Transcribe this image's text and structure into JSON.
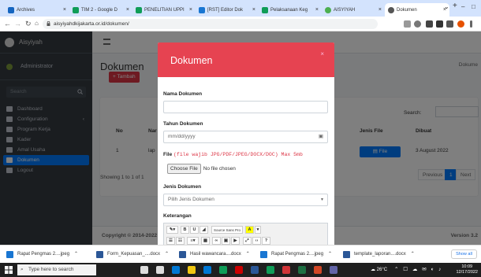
{
  "browser": {
    "tabs": [
      {
        "label": "Archives",
        "color": "#1565c0"
      },
      {
        "label": "TIM 2 - Google D",
        "color": "#0f9d58"
      },
      {
        "label": "PENELITIAN UPPI",
        "color": "#0f9d58"
      },
      {
        "label": "[RST] Editor Dok",
        "color": "#1976d2"
      },
      {
        "label": "Pelaksanaan Keg",
        "color": "#0f9d58"
      },
      {
        "label": "AISYIYAH",
        "color": "#4caf50"
      },
      {
        "label": "Dokumen",
        "color": "#555555"
      }
    ],
    "url": "aisyiyahdkijakarta.or.id/dokumen/"
  },
  "app": {
    "brand": "Aisyiyah",
    "user": "Administrator",
    "search_placeholder": "Search",
    "menu": [
      "Dashboard",
      "Configuration",
      "Program Kerja",
      "Kader",
      "Amal Usaha",
      "Dokumen",
      "Logout"
    ],
    "page_title": "Dokumen",
    "breadcrumb": "Dokume",
    "add_button": "+ Tambah",
    "search_label": "Search:",
    "table": {
      "headers": [
        "No",
        "Nar",
        "Jenis File",
        "Dibuat"
      ],
      "row": {
        "no": "1",
        "name": "lap",
        "file_button": "File",
        "date": "3 August 2022"
      }
    },
    "info": "Showing 1 to 1 of 1",
    "pagination": {
      "prev": "Previous",
      "page": "1",
      "next": "Next"
    },
    "footer_left": "Copyright © 2014-2022",
    "footer_right": "Version 3.2"
  },
  "modal": {
    "title": "Dokumen",
    "close": "×",
    "fields": {
      "nama_label": "Nama Dokumen",
      "tahun_label": "Tahun Dokumen",
      "tahun_placeholder": "mm/dd/yyyy",
      "file_label": "File",
      "file_note": "(file wajib JPG/PDF/JPEG/DOCX/DOC) Max 5mb",
      "choose_button": "Choose File",
      "no_file": "No file chosen",
      "jenis_label": "Jenis Dokumen",
      "jenis_selected": "Pilih Jenis Dokumen",
      "ket_label": "Keterangan",
      "font_select": "Source Sans Pro"
    }
  },
  "downloads": {
    "items": [
      "Rapat Pengmas 2....jpeg",
      "Form_Kepuasan_....docx",
      "Hasil wawancara....docx",
      "Rapat Pengmas 2....jpeg",
      "template_laporan....docx"
    ],
    "show_all": "Show all"
  },
  "taskbar": {
    "search_placeholder": "Type here to search",
    "weather": "26°C",
    "time": "10:09",
    "date": "12/17/2022"
  }
}
